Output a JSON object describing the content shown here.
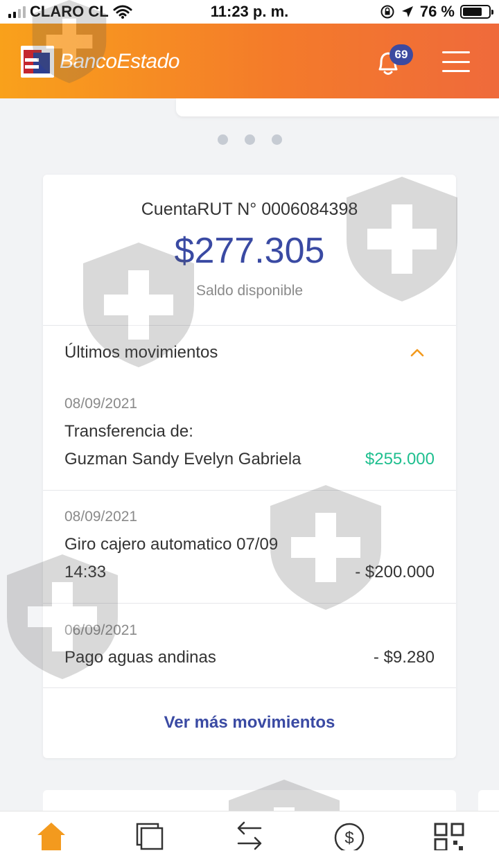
{
  "status_bar": {
    "carrier": "CLARO CL",
    "time": "11:23 p. m.",
    "battery_percent": "76 %",
    "battery_level": 0.76
  },
  "header": {
    "brand": "BancoEstado",
    "notifications_count": "69",
    "brand_colors": {
      "gradient_start": "#f9a11b",
      "gradient_end": "#ef6a3b",
      "accent": "#3a4aa3"
    }
  },
  "carousel": {
    "pages": 3
  },
  "account": {
    "name": "CuentaRUT N° 0006084398",
    "balance": "$277.305",
    "balance_label": "Saldo disponible"
  },
  "movements": {
    "title": "Últimos movimientos",
    "items": [
      {
        "date": "08/09/2021",
        "line1": "Transferencia de:",
        "line2": "Guzman Sandy Evelyn Gabriela",
        "amount": "$255.000",
        "positive": true
      },
      {
        "date": "08/09/2021",
        "line1": "Giro cajero automatico 07/09",
        "line2": "14:33",
        "amount": "- $200.000",
        "positive": false
      },
      {
        "date": "06/09/2021",
        "line1": "Pago aguas andinas",
        "line2": "",
        "amount": "- $9.280",
        "positive": false
      }
    ],
    "more_label": "Ver más movimientos"
  },
  "bottom_nav": {
    "items": [
      "home-icon",
      "cards-icon",
      "transfer-icon",
      "payments-icon",
      "qr-icon"
    ],
    "active_color": "#f39a1e",
    "inactive_color": "#333333"
  }
}
